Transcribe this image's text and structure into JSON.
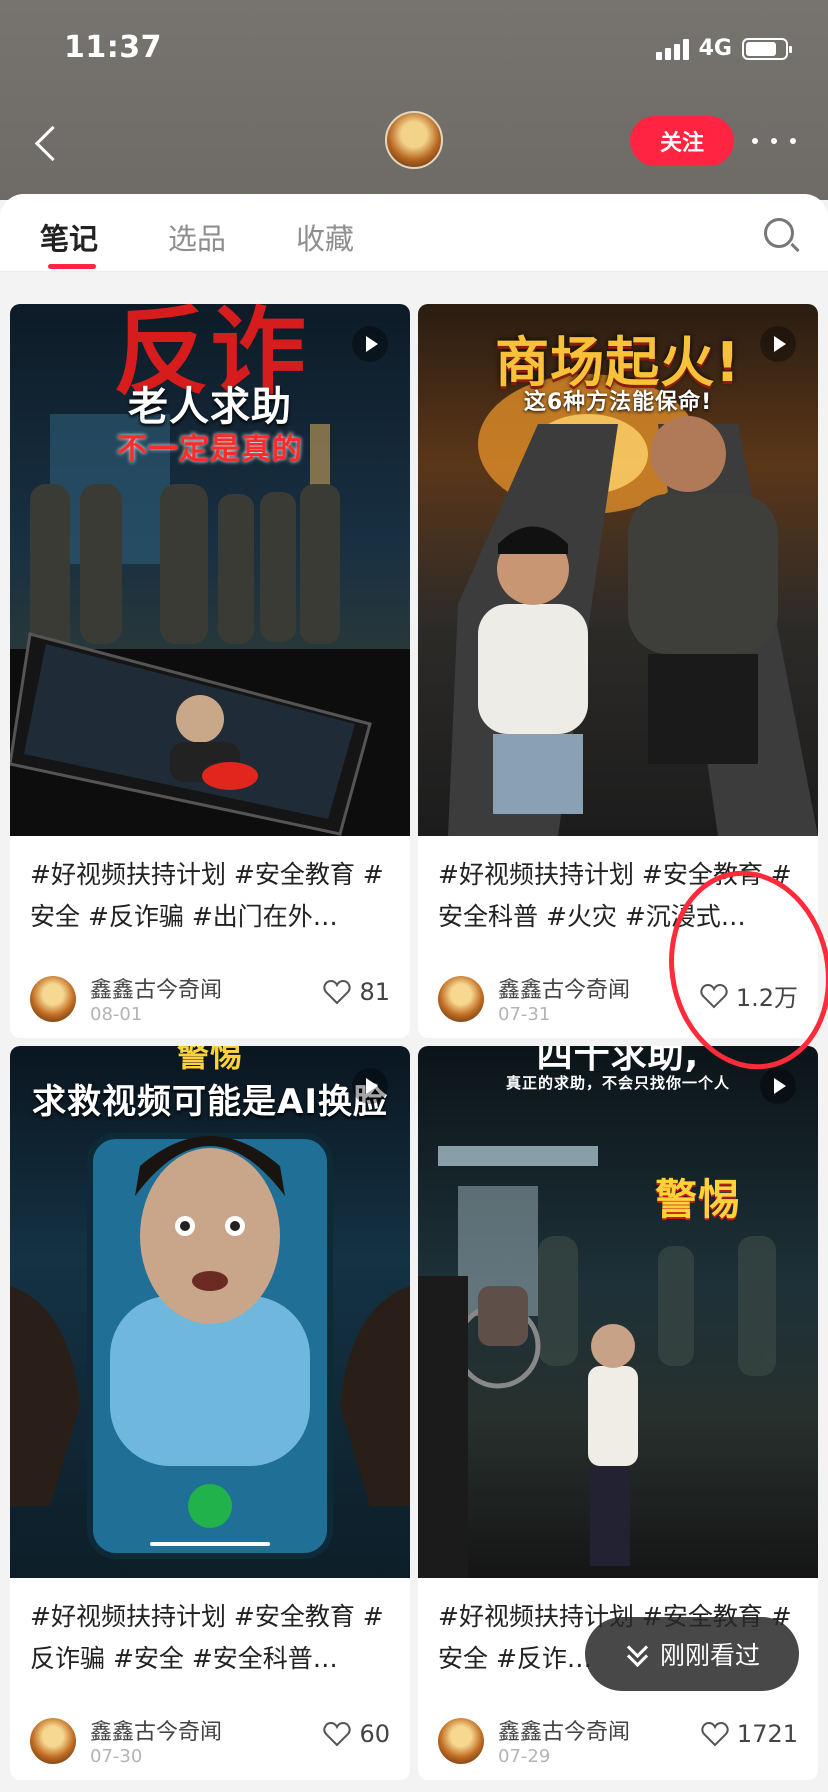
{
  "status": {
    "time": "11:37",
    "network": "4G"
  },
  "header": {
    "follow_label": "关注"
  },
  "tabs": [
    "笔记",
    "选品",
    "收藏"
  ],
  "cards": [
    {
      "overlay_top": "反诈",
      "overlay_title": "老人求助",
      "overlay_sub": "不一定是真的",
      "caption": "#好视频扶持计划 #安全教育 #安全 #反诈骗 #出门在外…",
      "author": "鑫鑫古今奇闻",
      "date": "08-01",
      "likes": "81"
    },
    {
      "overlay_title": "商场起火!",
      "overlay_sub": "这6种方法能保命!",
      "caption": "#好视频扶持计划 #安全教育 #安全科普 #火灾 #沉浸式…",
      "author": "鑫鑫古今奇闻",
      "date": "07-31",
      "likes": "1.2万"
    },
    {
      "overlay_top": "警惕",
      "overlay_title": "求救视频可能是AI换脸",
      "caption": "#好视频扶持计划 #安全教育 #反诈骗 #安全 #安全科普…",
      "author": "鑫鑫古今奇闻",
      "date": "07-30",
      "likes": "60"
    },
    {
      "overlay_top": "四十求助,",
      "overlay_title": "真正的求助，不会只找你一个人",
      "overlay_sub": "警惕",
      "caption": "#好视频扶持计划 #安全教育 #安全 #反诈…",
      "author": "鑫鑫古今奇闻",
      "date": "07-29",
      "likes": "1721"
    }
  ],
  "recent_label": "刚刚看过",
  "colors": {
    "accent": "#ff2442",
    "annotation": "#ff2b3a"
  }
}
